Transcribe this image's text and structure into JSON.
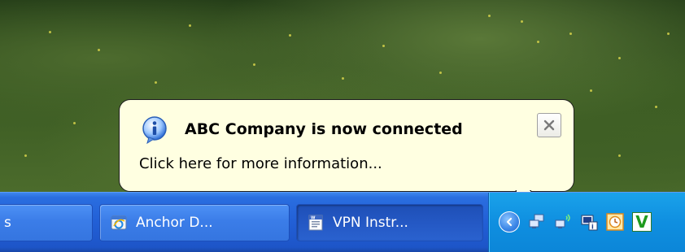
{
  "balloon": {
    "title": "ABC Company is now connected",
    "message": "Click here for more information...",
    "close_symbol": "×",
    "info_icon": "info-icon"
  },
  "taskbar": {
    "items": [
      {
        "label": "s",
        "icon": "none",
        "active": false
      },
      {
        "label": "Anchor D...",
        "icon": "internet-explorer-icon",
        "active": false
      },
      {
        "label": "VPN Instr...",
        "icon": "word-document-icon",
        "active": true
      }
    ]
  },
  "tray": {
    "icons": [
      "show-hidden-icons-chevron",
      "network-connection-icon",
      "wireless-network-icon",
      "network-info-icon",
      "clock-icon",
      "antivirus-icon"
    ],
    "antivirus_letter": "V"
  },
  "colors": {
    "balloon_bg": "#ffffe1",
    "taskbar_blue": "#225fd6",
    "tray_blue": "#0f8fe0"
  }
}
